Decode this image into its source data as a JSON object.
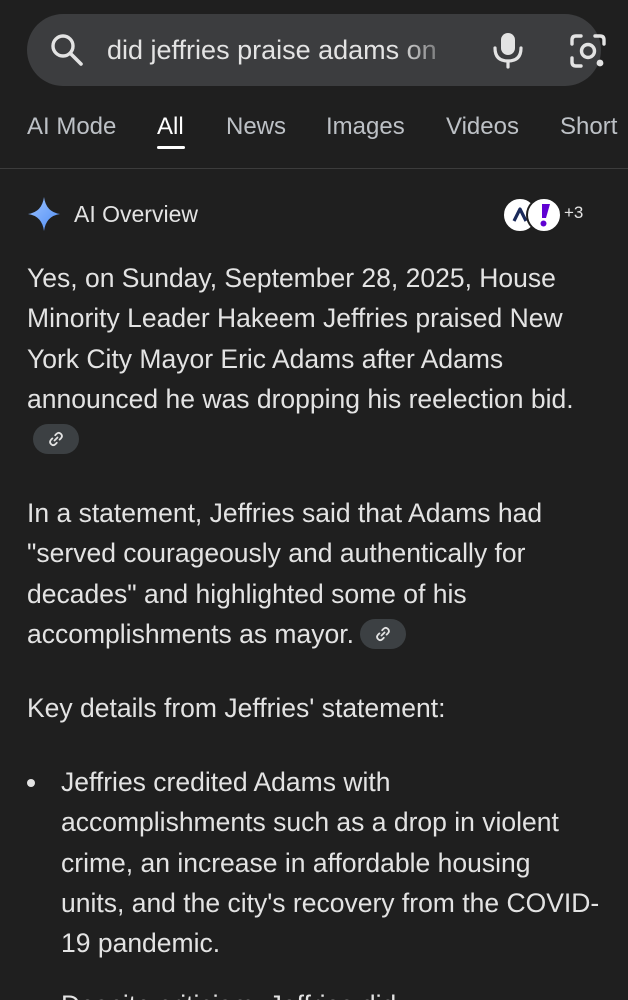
{
  "search": {
    "query": "did jeffries praise adams on",
    "icons": [
      "search-icon",
      "mic-icon",
      "lens-icon"
    ]
  },
  "tabs": [
    {
      "label": "AI Mode",
      "active": false
    },
    {
      "label": "All",
      "active": true
    },
    {
      "label": "News",
      "active": false
    },
    {
      "label": "Images",
      "active": false
    },
    {
      "label": "Videos",
      "active": false
    },
    {
      "label": "Short",
      "active": false
    }
  ],
  "ai_overview": {
    "title": "AI Overview",
    "sources_more": "+3",
    "source_avatar_letters": [
      "Λ",
      "Y!"
    ],
    "paragraphs": [
      "Yes, on Sunday, September 28, 2025, House Minority Leader Hakeem Jeffries praised New York City Mayor Eric Adams after Adams announced he was dropping his reelection bid.",
      "In a statement, Jeffries said that Adams had \"served courageously and authentically for decades\" and highlighted some of his accomplishments as mayor.",
      "Key details from Jeffries' statement:"
    ],
    "bullets": [
      "Jeffries credited Adams with accomplishments such as a drop in violent crime, an increase in affordable housing units, and the city's recovery from the COVID-19 pandemic."
    ],
    "truncated_next_line": "Despite criticism, Jeffries did"
  },
  "colors": {
    "background": "#1f1f1f",
    "search_bar": "#3c3d3f",
    "text": "#e3e3e3",
    "tab_inactive": "#bdc1c6",
    "sparkle_blue": "#7bb0ff",
    "chip": "#3c4043",
    "yahoo_purple": "#6001d2"
  }
}
